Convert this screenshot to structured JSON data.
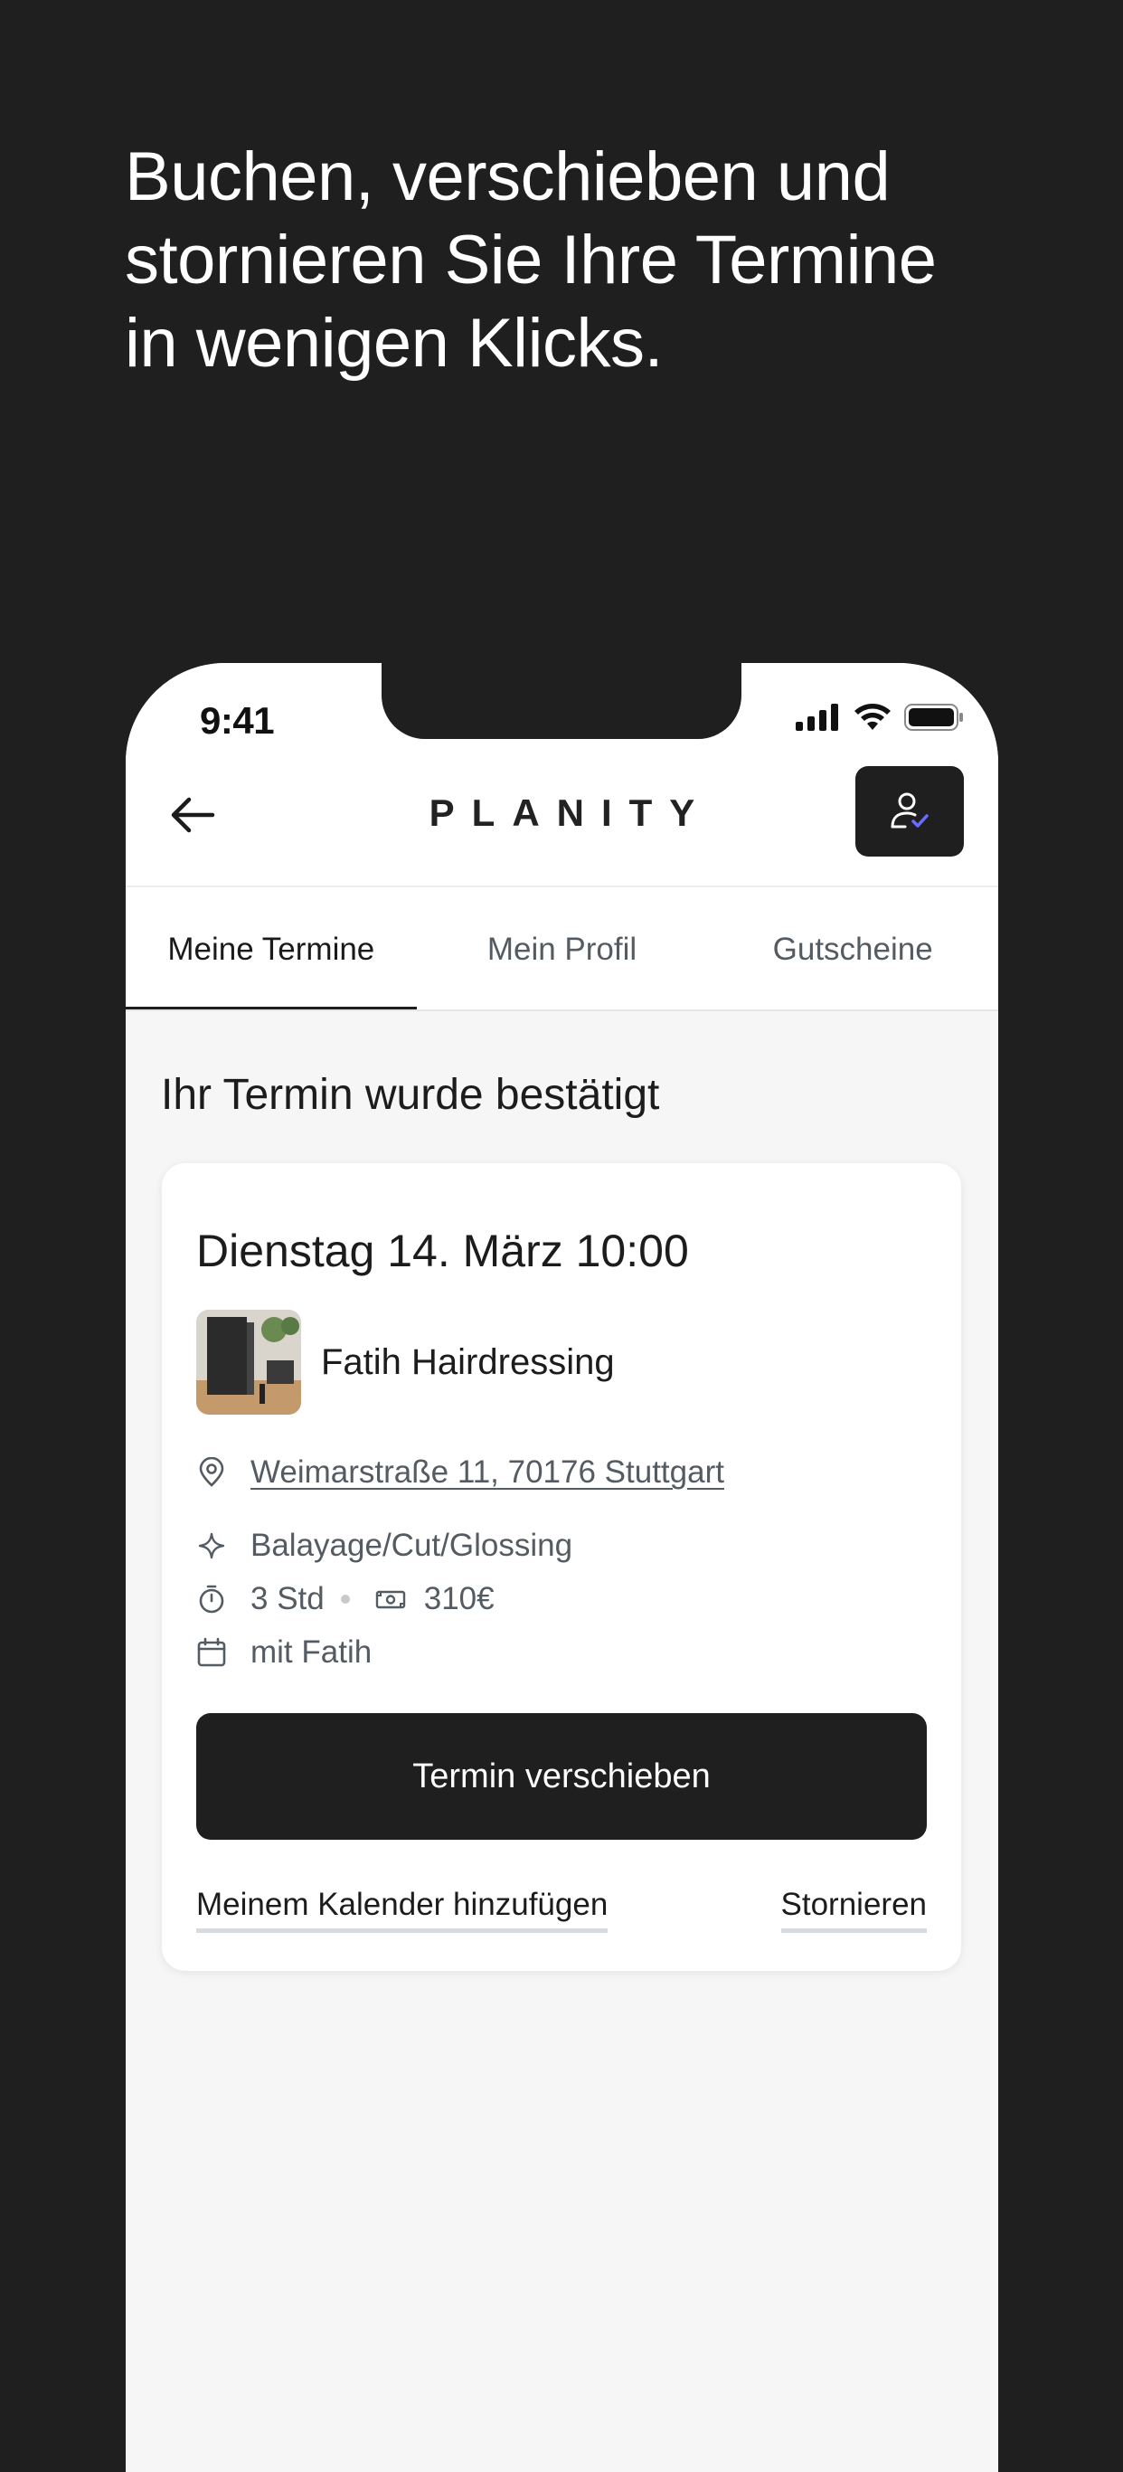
{
  "headline": [
    "Buchen, verschieben und",
    "stornieren Sie Ihre Termine",
    "in wenigen Klicks."
  ],
  "status_bar": {
    "time": "9:41"
  },
  "nav": {
    "logo": "PLANITY",
    "back_icon": "arrow-left-icon",
    "profile_icon": "user-check-icon"
  },
  "tabs": [
    {
      "label": "Meine Termine",
      "active": true
    },
    {
      "label": "Mein Profil",
      "active": false
    },
    {
      "label": "Gutscheine",
      "active": false
    }
  ],
  "confirmation_title": "Ihr Termin wurde bestätigt",
  "appointment": {
    "date": "Dienstag 14. März 10:00",
    "salon_name": "Fatih Hairdressing",
    "address": "Weimarstraße 11, 70176 Stuttgart",
    "service": "Balayage/Cut/Glossing",
    "duration": "3 Std",
    "price": "310€",
    "staff": "mit Fatih"
  },
  "actions": {
    "reschedule": "Termin verschieben",
    "add_calendar": "Meinem Kalender hinzufügen",
    "cancel": "Stornieren"
  },
  "colors": {
    "background": "#1f1f1f",
    "accent_check": "#6b6bff",
    "card": "#ffffff",
    "screen": "#f6f6f6"
  }
}
